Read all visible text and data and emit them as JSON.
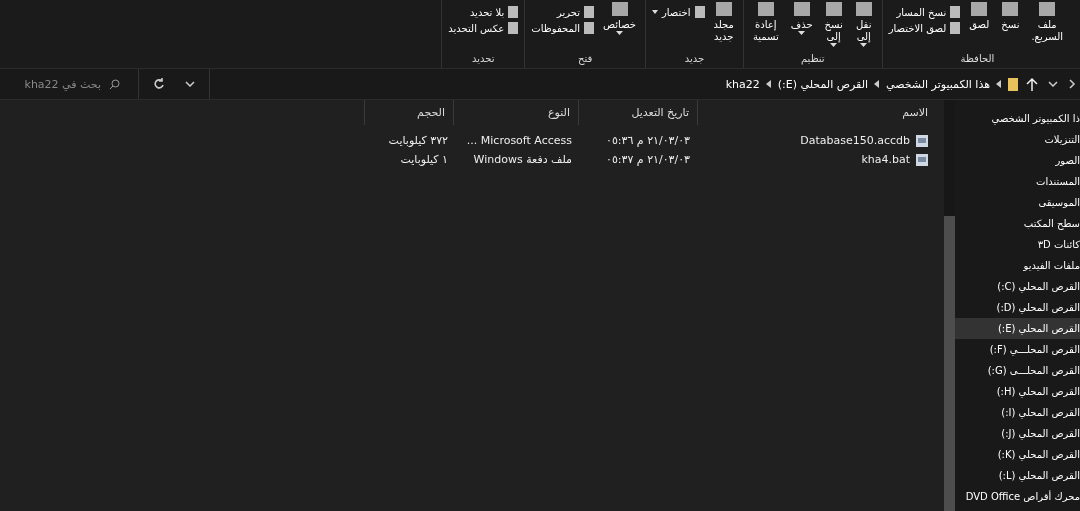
{
  "ribbon": {
    "groups": [
      {
        "label": "الحافظة",
        "items": [
          {
            "kind": "large",
            "lines": [
              "ملف",
              "السريع."
            ],
            "dropdown": false
          },
          {
            "kind": "large",
            "lines": [
              "نسخ"
            ],
            "dropdown": false
          },
          {
            "kind": "large",
            "lines": [
              "لصق"
            ],
            "dropdown": false
          },
          {
            "kind": "stack",
            "items": [
              {
                "label": "نسخ المسار",
                "dropdown": false
              },
              {
                "label": "لصق الاختصار",
                "dropdown": false
              }
            ]
          }
        ]
      },
      {
        "label": "تنظيم",
        "items": [
          {
            "kind": "large",
            "lines": [
              "نقل",
              "إلى"
            ],
            "dropdown": true
          },
          {
            "kind": "large",
            "lines": [
              "نسخ",
              "إلى"
            ],
            "dropdown": true
          },
          {
            "kind": "large",
            "lines": [
              "حذف"
            ],
            "dropdown": true
          },
          {
            "kind": "large",
            "lines": [
              "إعادة",
              "تسمية"
            ],
            "dropdown": false
          }
        ]
      },
      {
        "label": "جديد",
        "items": [
          {
            "kind": "large",
            "lines": [
              "مجلد",
              "جديد"
            ],
            "dropdown": false
          },
          {
            "kind": "stack",
            "items": [
              {
                "label": "اختصار",
                "dropdown": true
              }
            ]
          }
        ]
      },
      {
        "label": "فتح",
        "items": [
          {
            "kind": "large",
            "lines": [
              "خصائص"
            ],
            "dropdown": true
          },
          {
            "kind": "stack",
            "items": [
              {
                "label": "تحرير",
                "dropdown": false
              },
              {
                "label": "المحفوظات",
                "dropdown": false
              }
            ]
          }
        ]
      },
      {
        "label": "تحديد",
        "items": [
          {
            "kind": "stack",
            "items": [
              {
                "label": "بلا تحديد",
                "dropdown": false
              },
              {
                "label": "عكس التحديد",
                "dropdown": false
              }
            ]
          }
        ]
      }
    ]
  },
  "address": {
    "breadcrumb": [
      "هذا الكمبيوتر الشخصي",
      "القرص المحلي (E:)",
      "kha22"
    ]
  },
  "search": {
    "placeholder": "بحث في kha22"
  },
  "sidebar": {
    "items": [
      {
        "label": "ذا الكمبيوتر الشخصي",
        "selected": false
      },
      {
        "label": "التنزيلات",
        "selected": false
      },
      {
        "label": "الصور",
        "selected": false
      },
      {
        "label": "المستندات",
        "selected": false
      },
      {
        "label": "الموسيقى",
        "selected": false
      },
      {
        "label": "سطح المكتب",
        "selected": false
      },
      {
        "label": "كائنات ٣D",
        "selected": false
      },
      {
        "label": "ملفات الفيديو",
        "selected": false
      },
      {
        "label": "القرص المحلي (C:)",
        "selected": false
      },
      {
        "label": "القرص المحلي (D:)",
        "selected": false
      },
      {
        "label": "القرص المحلي (E:)",
        "selected": true
      },
      {
        "label": "القرص المحلـــي (F:)",
        "selected": false
      },
      {
        "label": "القرص المحلـــى (G:)",
        "selected": false
      },
      {
        "label": "القرص المحلي (H:)",
        "selected": false
      },
      {
        "label": "القرص المحلي (I:)",
        "selected": false
      },
      {
        "label": "القرص المحلي (J:)",
        "selected": false
      },
      {
        "label": "القرص المحلي (K:)",
        "selected": false
      },
      {
        "label": "القرص المحلي (L:)",
        "selected": false
      },
      {
        "label": "محرك أقراص DVD Office",
        "selected": false
      }
    ]
  },
  "table": {
    "columns": [
      "الاسم",
      "تاريخ التعديل",
      "النوع",
      "الحجم"
    ],
    "rows": [
      {
        "name": "Database150.accdb",
        "date": "٢١/٠٣/٠٣ م ٠٥:٣٦",
        "type": "Microsoft Access ...",
        "size": "٣٧٢ كيلوبايت"
      },
      {
        "name": "kha4.bat",
        "date": "٢١/٠٣/٠٣ م ٠٥:٣٧",
        "type": "ملف دفعة Windows",
        "size": "١ كيلوبايت"
      }
    ]
  }
}
